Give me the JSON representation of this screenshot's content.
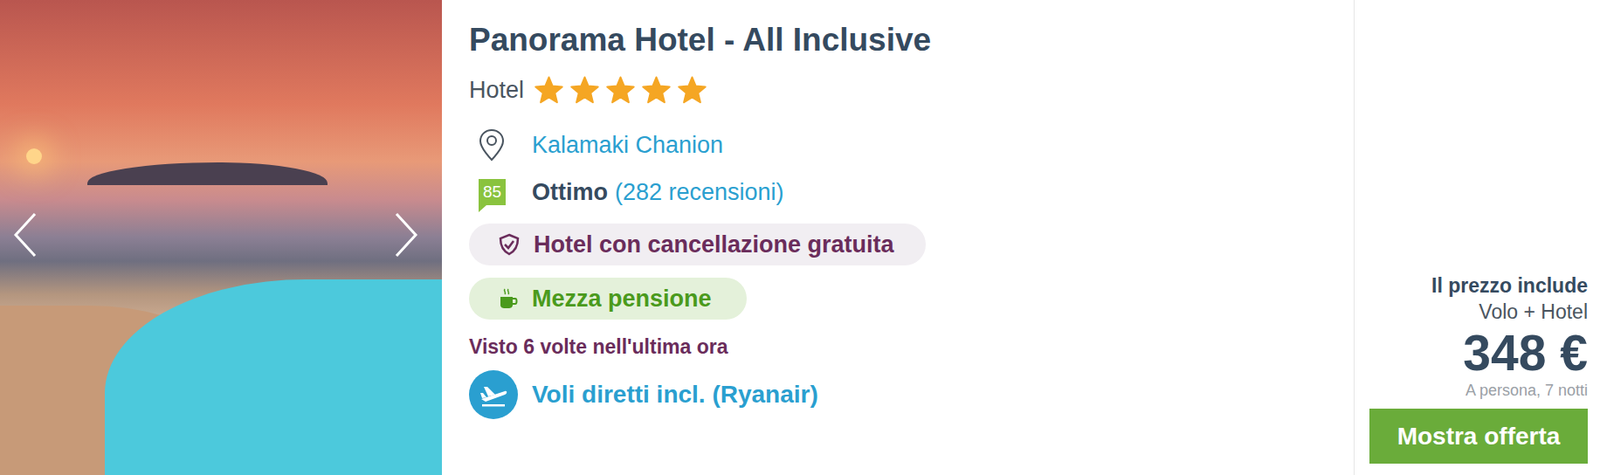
{
  "hotel": {
    "name": "Panorama Hotel - All Inclusive",
    "category": "Hotel",
    "stars": 5,
    "location": "Kalamaki Chanion",
    "rating": {
      "score": "85",
      "label": "Ottimo",
      "reviews": "(282 recensioni)"
    },
    "cancellation": "Hotel con cancellazione gratuita",
    "board": "Mezza pensione",
    "views": "Visto 6 volte nell'ultima ora",
    "flights": "Voli diretti incl. (Ryanair)"
  },
  "price": {
    "includes_label": "Il prezzo include",
    "includes": "Volo + Hotel",
    "amount": "348 €",
    "note": "A persona, 7 notti"
  },
  "cta": "Mostra offerta"
}
